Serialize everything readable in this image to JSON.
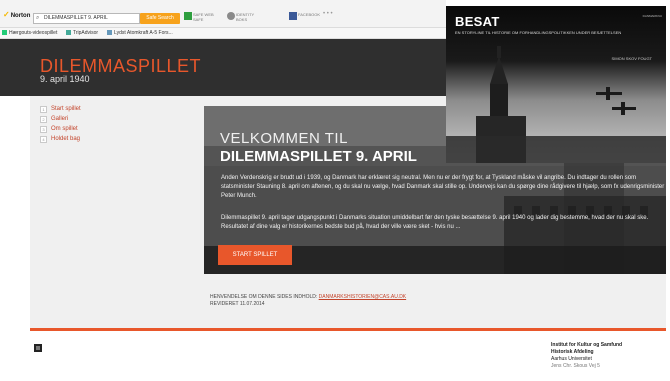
{
  "toolbar": {
    "brand": "Norton",
    "search_value": "DILEMMASPILLET 9. APRIL",
    "search_button": "Safe Search",
    "safe_web": "SAFE WEB\nSAFE",
    "identity": "IDENTITY\nBOKS",
    "facebook": "FACEBOOK",
    "more": "• • •",
    "colors": {
      "safe_search": "#f7a21b",
      "facebook": "#3b5998",
      "safe_web": "#2e9e3e"
    }
  },
  "bookmarks": [
    {
      "label": "Hærgouts-videospillet",
      "icon": "bookmark-icon"
    },
    {
      "label": "TripAdvisor",
      "icon": "bookmark-icon"
    },
    {
      "label": "Lydst Atomkraft A-5 Fors...",
      "icon": "bookmark-icon"
    }
  ],
  "site": {
    "title": "DILEMMASPILLET",
    "subtitle": "9. april 1940",
    "accent_color": "#e8572b"
  },
  "nav": [
    {
      "num": "1",
      "label": "Start spillet"
    },
    {
      "num": "2",
      "label": "Galleri"
    },
    {
      "num": "3",
      "label": "Om spillet"
    },
    {
      "num": "4",
      "label": "Holdet bag"
    }
  ],
  "hero": {
    "welcome": "VELKOMMEN TIL",
    "heading": "DILEMMASPILLET 9. APRIL",
    "paragraph1": "Anden Verdenskrig er brudt ud i 1939, og Danmark har erklæret sig neutral. Men nu er der frygt for, at Tyskland måske vil angribe. Du indtager du rollen som statsminister Stauning 8. april om aftenen, og du skal nu vælge, hvad Danmark skal stille op. Undervejs kan du spørge dine rådgivere til hjælp, som fx udenrigsminister Peter Munch.",
    "paragraph2": "Dilemmaspillet 9. april tager udgangspunkt i Danmarks situation umiddelbart før den tyske besættelse 9. april 1940 og lader dig bestemme, hvad der nu skal ske. Resultatet af dine valg er historikernes bedste bud på, hvad der ville være sket - hvis nu ...",
    "start_button": "START SPILLET"
  },
  "contact": {
    "label": "HENVENDELSE OM DENNE SIDES INDHOLD:",
    "email": "DANMARKSHISTORIEN@CAS.AU.DK",
    "revised": "REVIDERET 11.07.2014"
  },
  "institution": {
    "line1": "Institut for Kultur og Samfund",
    "line2": "Historisk Afdeling",
    "line3": "Aarhus Universitet",
    "line4": "Jens Chr. Skous Vej 5"
  },
  "besat": {
    "title": "BESAT",
    "tagline": "EN STORYLINE TIL HISTORIE OM FORHANDLINGSPOLITIKKEN UNDER BESÆTTELSEN",
    "author": "SIMON SKOV FOUGT",
    "link": "DANMARKNU"
  }
}
